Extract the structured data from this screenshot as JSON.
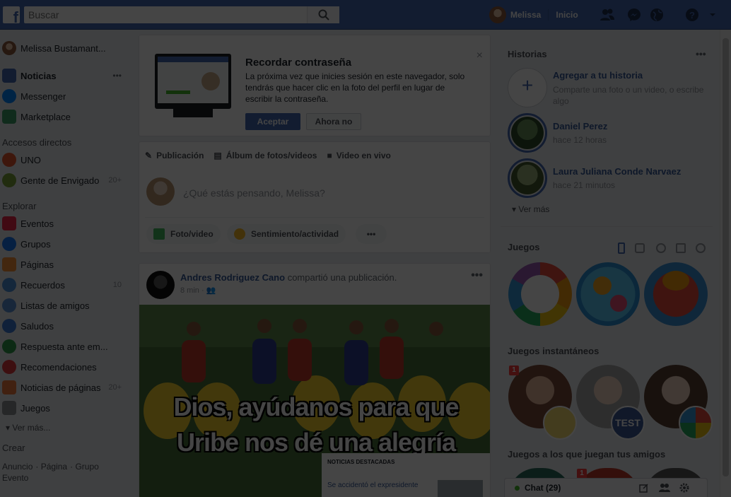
{
  "colors": {
    "brand": "#4267b2",
    "dim_overlay": "rgba(0,0,0,0.73)",
    "online": "#42b72a"
  },
  "topbar": {
    "logo": "f",
    "search_placeholder": "Buscar",
    "user_name": "Melissa",
    "home": "Inicio",
    "icons": [
      "friend-requests-icon",
      "messenger-icon",
      "notifications-globe-icon",
      "help-icon",
      "dropdown-arrow-icon"
    ]
  },
  "sidebar": {
    "profile": "Melissa Bustamant...",
    "main": [
      {
        "label": "Noticias",
        "bold": true,
        "more": "•••"
      },
      {
        "label": "Messenger"
      },
      {
        "label": "Marketplace"
      }
    ],
    "shortcuts_title": "Accesos directos",
    "shortcuts": [
      {
        "label": "UNO"
      },
      {
        "label": "Gente de Envigado",
        "count": "20+"
      }
    ],
    "explore_title": "Explorar",
    "explore": [
      {
        "label": "Eventos"
      },
      {
        "label": "Grupos"
      },
      {
        "label": "Páginas"
      },
      {
        "label": "Recuerdos",
        "count": "10"
      },
      {
        "label": "Listas de amigos"
      },
      {
        "label": "Saludos"
      },
      {
        "label": "Respuesta ante em..."
      },
      {
        "label": "Recomendaciones"
      },
      {
        "label": "Noticias de páginas",
        "count": "20+"
      },
      {
        "label": "Juegos"
      }
    ],
    "see_more": "Ver más...",
    "create_title": "Crear",
    "create_links": [
      "Anuncio",
      "Página",
      "Grupo",
      "Evento"
    ]
  },
  "password_card": {
    "title": "Recordar contraseña",
    "body": "La próxima vez que inicies sesión en este navegador, solo tendrás que hacer clic en la foto del perfil en lugar de escribir la contraseña.",
    "accept": "Aceptar",
    "later": "Ahora no",
    "close": "×"
  },
  "composer": {
    "tabs": [
      "Publicación",
      "Álbum de fotos/videos",
      "Video en vivo"
    ],
    "placeholder": "¿Qué estás pensando, Melissa?",
    "actions": [
      "Foto/video",
      "Sentimiento/actividad"
    ],
    "more": "•••"
  },
  "post": {
    "author": "Andres Rodriguez Cano",
    "action": "compartió una publicación.",
    "time": "8 min",
    "more": "•••",
    "meme_line1": "Dios, ayúdanos para que",
    "meme_line2": "Uribe nos dé una alegría",
    "news_head": "NOTICIAS DESTACADAS",
    "news_item": "Se accidentó el expresidente"
  },
  "right": {
    "stories_title": "Historias",
    "stories_more": "•••",
    "add_story_title": "Agregar a tu historia",
    "add_story_sub": "Comparte una foto o un video, o escribe algo",
    "stories": [
      {
        "name": "Daniel Perez",
        "time": "hace 12 horas"
      },
      {
        "name": "Laura Juliana Conde Narvaez",
        "time": "hace 21 minutos"
      }
    ],
    "see_more": "Ver más",
    "games_title": "Juegos",
    "instant_games_title": "Juegos instantáneos",
    "friends_games_title": "Juegos a los que juegan tus amigos",
    "badge_count": "1",
    "test_badge": "TEST"
  },
  "chat": {
    "label": "Chat (29)"
  }
}
